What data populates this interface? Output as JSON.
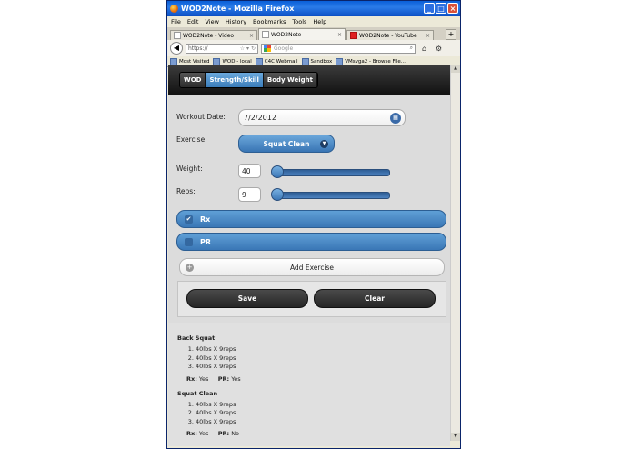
{
  "window": {
    "title": "WOD2Note - Mozilla Firefox"
  },
  "menu": [
    "File",
    "Edit",
    "View",
    "History",
    "Bookmarks",
    "Tools",
    "Help"
  ],
  "tabs": [
    {
      "label": "WOD2Note - Video"
    },
    {
      "label": "WOD2Note"
    },
    {
      "label": "WOD2Note - YouTube"
    }
  ],
  "nav": {
    "url": "https://",
    "search_placeholder": "Google"
  },
  "bookmarks": [
    "Most Visited",
    "WOD - local",
    "C4C Webmail",
    "Sandbox",
    "VMsvga2 - Browse File..."
  ],
  "app": {
    "tabs": [
      {
        "label": "WOD",
        "active": false
      },
      {
        "label": "Strength/Skill",
        "active": true
      },
      {
        "label": "Body Weight",
        "active": false
      }
    ],
    "form": {
      "date_label": "Workout Date:",
      "date_value": "7/2/2012",
      "exercise_label": "Exercise:",
      "exercise_value": "Squat Clean",
      "weight_label": "Weight:",
      "weight_value": "40",
      "reps_label": "Reps:",
      "reps_value": "9",
      "rx_label": "Rx",
      "rx_checked": true,
      "pr_label": "PR",
      "pr_checked": false,
      "add_label": "Add Exercise",
      "save_label": "Save",
      "clear_label": "Clear"
    },
    "history": [
      {
        "name": "Back Squat",
        "sets": [
          "40lbs X 9reps",
          "40lbs X 9reps",
          "40lbs X 9reps"
        ],
        "rx_label": "Rx:",
        "rx": "Yes",
        "pr_label": "PR:",
        "pr": "Yes"
      },
      {
        "name": "Squat Clean",
        "sets": [
          "40lbs X 9reps",
          "40lbs X 9reps",
          "40lbs X 9reps"
        ],
        "rx_label": "Rx:",
        "rx": "Yes",
        "pr_label": "PR:",
        "pr": "No"
      }
    ]
  },
  "colors": {
    "accent": "#3a77b6",
    "header": "#1a1a1a",
    "titlebar": "#0a5fd8"
  }
}
